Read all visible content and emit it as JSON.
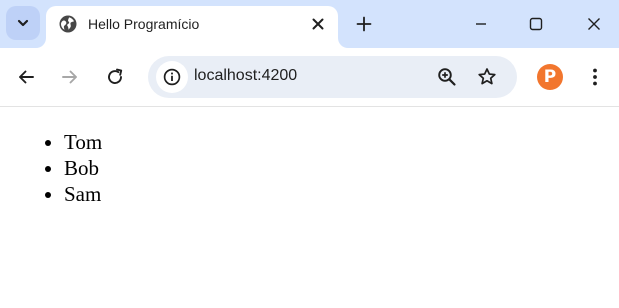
{
  "browser": {
    "tab": {
      "title": "Hello Programício",
      "favicon": "globe-icon"
    },
    "address_bar": {
      "url": "localhost:4200"
    },
    "icons": {
      "tab_search": "chevron-down-icon",
      "tab_close": "close-icon",
      "new_tab": "plus-icon",
      "minimize": "minimize-icon",
      "maximize": "maximize-icon",
      "close_window": "close-icon",
      "back": "arrow-left-icon",
      "forward": "arrow-right-icon",
      "reload": "reload-icon",
      "site_info": "info-icon",
      "zoom": "zoom-in-icon",
      "bookmark": "star-icon",
      "extension": "extension-p-icon",
      "menu": "kebab-menu-icon"
    },
    "extension_letter": "P"
  },
  "page": {
    "items": [
      "Tom",
      "Bob",
      "Sam"
    ]
  },
  "colors": {
    "tabstrip_bg": "#d3e3fd",
    "omnibox_bg": "#e9eef6",
    "icon": "#1f1f1f",
    "icon_disabled": "#a7a7a7",
    "extension_bg": "#f2762e"
  }
}
